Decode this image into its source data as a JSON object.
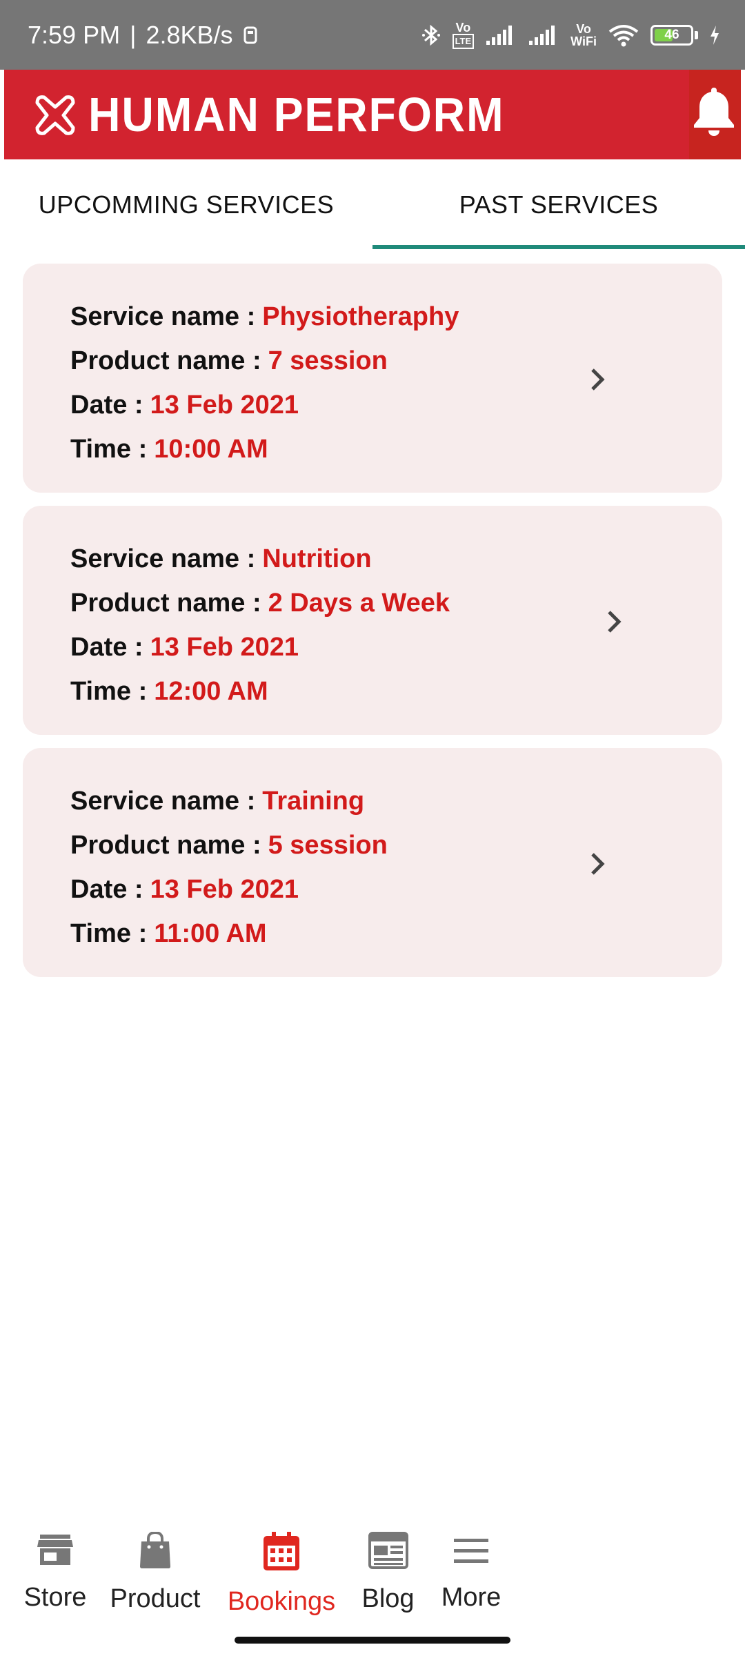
{
  "status_bar": {
    "time": "7:59 PM",
    "separator": "|",
    "speed": "2.8KB/s",
    "volte_top": "Vo",
    "volte_bottom": "LTE",
    "vowifi_top": "Vo",
    "vowifi_bottom": "WiFi",
    "battery_level": "46",
    "battery_fraction": 0.46
  },
  "header": {
    "brand": "HUMAN PERFORM",
    "brand_color": "#d2232f"
  },
  "tabs": {
    "upcoming": "UPCOMMING SERVICES",
    "past": "PAST SERVICES",
    "active": "past",
    "indicator_color": "#1f8a7a"
  },
  "bookings": [
    {
      "service_label": "Service name :",
      "service": "Physiotheraphy",
      "product_label": "Product name :",
      "product": "7 session",
      "date_label": "Date :",
      "date": "13 Feb 2021",
      "time_label": "Time :",
      "time": "10:00 AM"
    },
    {
      "service_label": "Service name :",
      "service": "Nutrition",
      "product_label": "Product name :",
      "product": "2 Days a Week",
      "date_label": "Date :",
      "date": "13 Feb 2021",
      "time_label": "Time :",
      "time": "12:00 AM"
    },
    {
      "service_label": "Service name :",
      "service": "Training",
      "product_label": "Product name :",
      "product": "5 session",
      "date_label": "Date :",
      "date": "13 Feb 2021",
      "time_label": "Time :",
      "time": "11:00 AM"
    }
  ],
  "nav": {
    "store": "Store",
    "product": "Product",
    "bookings": "Bookings",
    "blog": "Blog",
    "more": "More",
    "active": "bookings",
    "active_color": "#e0271f"
  }
}
